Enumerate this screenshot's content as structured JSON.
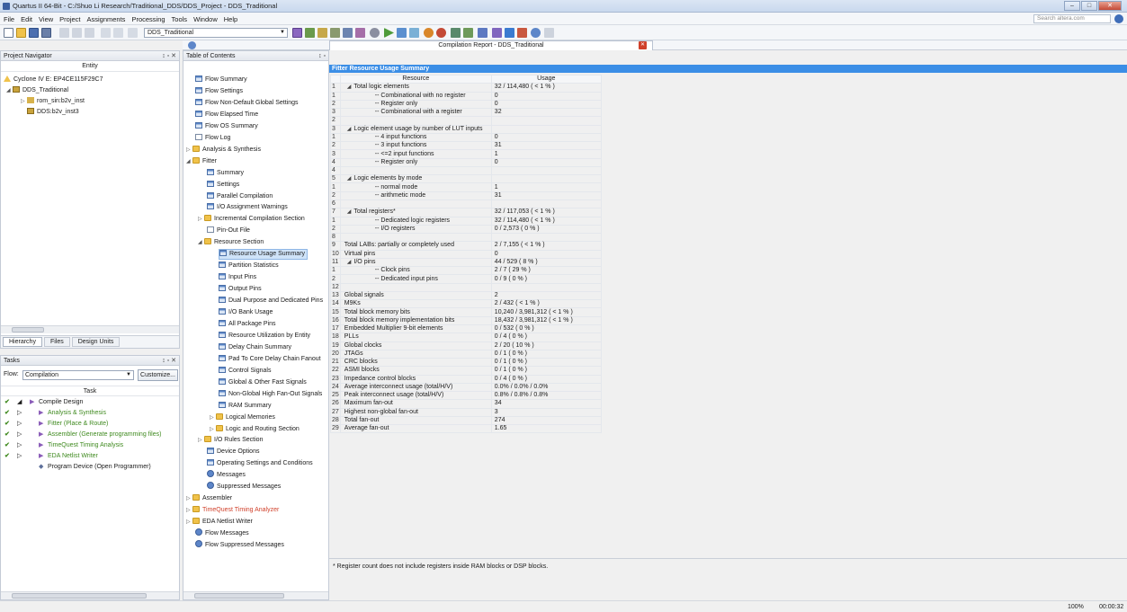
{
  "window": {
    "title": "Quartus II 64-Bit - C:/Shuo Li Research/Traditional_DDS/DDS_Project - DDS_Traditional",
    "buttons": [
      "–",
      "□",
      "✕"
    ]
  },
  "menubar": {
    "items": [
      "File",
      "Edit",
      "View",
      "Project",
      "Assignments",
      "Processing",
      "Tools",
      "Window",
      "Help"
    ],
    "search_placeholder": "Search altera.com"
  },
  "toolbar": {
    "revision": "DDS_Traditional"
  },
  "project_navigator": {
    "title": "Project Navigator",
    "header_controls": "↕ ▫ ✕",
    "column": "Entity",
    "device": "Cyclone IV E: EP4CE115F29C7",
    "tree": [
      {
        "label": "DDS_Traditional",
        "level": 0,
        "expanded": true
      },
      {
        "label": "rom_sin:b2v_inst",
        "level": 1,
        "expanded": false
      },
      {
        "label": "DDS:b2v_inst3",
        "level": 1,
        "expanded": null
      }
    ],
    "tabs": [
      "Hierarchy",
      "Files",
      "Design Units"
    ]
  },
  "tasks": {
    "title": "Tasks",
    "header_controls": "↕ ▫ ✕",
    "flow_label": "Flow:",
    "flow_value": "Compilation",
    "customize": "Customize...",
    "column": "Task",
    "items": [
      {
        "label": "Compile Design",
        "done": true,
        "level": 0,
        "green": false
      },
      {
        "label": "Analysis & Synthesis",
        "done": true,
        "level": 1,
        "green": true
      },
      {
        "label": "Fitter (Place & Route)",
        "done": true,
        "level": 1,
        "green": true
      },
      {
        "label": "Assembler (Generate programming files)",
        "done": true,
        "level": 1,
        "green": true
      },
      {
        "label": "TimeQuest Timing Analysis",
        "done": true,
        "level": 1,
        "green": true
      },
      {
        "label": "EDA Netlist Writer",
        "done": true,
        "level": 1,
        "green": true
      },
      {
        "label": "Program Device (Open Programmer)",
        "done": false,
        "level": 1,
        "green": false
      }
    ]
  },
  "toc": {
    "title": "Table of Contents",
    "header_controls": "↕ ▫",
    "items": [
      {
        "label": "Flow Summary",
        "icon": "table",
        "level": 0
      },
      {
        "label": "Flow Settings",
        "icon": "table",
        "level": 0
      },
      {
        "label": "Flow Non-Default Global Settings",
        "icon": "table",
        "level": 0
      },
      {
        "label": "Flow Elapsed Time",
        "icon": "table",
        "level": 0
      },
      {
        "label": "Flow OS Summary",
        "icon": "table",
        "level": 0
      },
      {
        "label": "Flow Log",
        "icon": "doc",
        "level": 0
      },
      {
        "label": "Analysis & Synthesis",
        "icon": "folder",
        "level": 0,
        "tri": "▷"
      },
      {
        "label": "Fitter",
        "icon": "folder",
        "level": 0,
        "tri": "◢"
      },
      {
        "label": "Summary",
        "icon": "table",
        "level": 1
      },
      {
        "label": "Settings",
        "icon": "table",
        "level": 1
      },
      {
        "label": "Parallel Compilation",
        "icon": "table",
        "level": 1
      },
      {
        "label": "I/O Assignment Warnings",
        "icon": "table",
        "level": 1
      },
      {
        "label": "Incremental Compilation Section",
        "icon": "folder",
        "level": 1,
        "tri": "▷"
      },
      {
        "label": "Pin-Out File",
        "icon": "doc",
        "level": 1
      },
      {
        "label": "Resource Section",
        "icon": "folder",
        "level": 1,
        "tri": "◢"
      },
      {
        "label": "Resource Usage Summary",
        "icon": "table",
        "level": 2,
        "selected": true
      },
      {
        "label": "Partition Statistics",
        "icon": "table",
        "level": 2
      },
      {
        "label": "Input Pins",
        "icon": "table",
        "level": 2
      },
      {
        "label": "Output Pins",
        "icon": "table",
        "level": 2
      },
      {
        "label": "Dual Purpose and Dedicated Pins",
        "icon": "table",
        "level": 2
      },
      {
        "label": "I/O Bank Usage",
        "icon": "table",
        "level": 2
      },
      {
        "label": "All Package Pins",
        "icon": "table",
        "level": 2
      },
      {
        "label": "Resource Utilization by Entity",
        "icon": "table",
        "level": 2
      },
      {
        "label": "Delay Chain Summary",
        "icon": "table",
        "level": 2
      },
      {
        "label": "Pad To Core Delay Chain Fanout",
        "icon": "table",
        "level": 2
      },
      {
        "label": "Control Signals",
        "icon": "table",
        "level": 2
      },
      {
        "label": "Global & Other Fast Signals",
        "icon": "table",
        "level": 2
      },
      {
        "label": "Non-Global High Fan-Out Signals",
        "icon": "table",
        "level": 2
      },
      {
        "label": "RAM Summary",
        "icon": "table",
        "level": 2
      },
      {
        "label": "Logical Memories",
        "icon": "folder",
        "level": 2,
        "tri": "▷"
      },
      {
        "label": "Logic and Routing Section",
        "icon": "folder",
        "level": 2,
        "tri": "▷"
      },
      {
        "label": "I/O Rules Section",
        "icon": "folder",
        "level": 1,
        "tri": "▷"
      },
      {
        "label": "Device Options",
        "icon": "table",
        "level": 1
      },
      {
        "label": "Operating Settings and Conditions",
        "icon": "table",
        "level": 1
      },
      {
        "label": "Messages",
        "icon": "info",
        "level": 1
      },
      {
        "label": "Suppressed Messages",
        "icon": "info",
        "level": 1
      },
      {
        "label": "Assembler",
        "icon": "folder",
        "level": 0,
        "tri": "▷"
      },
      {
        "label": "TimeQuest Timing Analyzer",
        "icon": "folder",
        "level": 0,
        "tri": "▷",
        "red": true
      },
      {
        "label": "EDA Netlist Writer",
        "icon": "folder",
        "level": 0,
        "tri": "▷"
      },
      {
        "label": "Flow Messages",
        "icon": "info",
        "level": 0
      },
      {
        "label": "Flow Suppressed Messages",
        "icon": "info",
        "level": 0
      }
    ]
  },
  "report": {
    "tab_title": "Compilation Report - DDS_Traditional",
    "heading": "Fitter Resource Usage Summary",
    "col_resource": "Resource",
    "col_usage": "Usage",
    "rows": [
      {
        "n": "1",
        "r": "Total logic elements",
        "u": "32 / 114,480 ( < 1 % )",
        "ind": 1,
        "tri": "◢"
      },
      {
        "n": "1",
        "r": "-- Combinational with no register",
        "u": "0",
        "ind": 2
      },
      {
        "n": "2",
        "r": "-- Register only",
        "u": "0",
        "ind": 2
      },
      {
        "n": "3",
        "r": "-- Combinational with a register",
        "u": "32",
        "ind": 2
      },
      {
        "n": "2",
        "r": "",
        "u": "",
        "ind": 0
      },
      {
        "n": "3",
        "r": "Logic element usage by number of LUT inputs",
        "u": "",
        "ind": 1,
        "tri": "◢"
      },
      {
        "n": "1",
        "r": "-- 4 input functions",
        "u": "0",
        "ind": 2
      },
      {
        "n": "2",
        "r": "-- 3 input functions",
        "u": "31",
        "ind": 2
      },
      {
        "n": "3",
        "r": "-- <=2 input functions",
        "u": "1",
        "ind": 2
      },
      {
        "n": "4",
        "r": "-- Register only",
        "u": "0",
        "ind": 2
      },
      {
        "n": "4",
        "r": "",
        "u": "",
        "ind": 0
      },
      {
        "n": "5",
        "r": "Logic elements by mode",
        "u": "",
        "ind": 1,
        "tri": "◢"
      },
      {
        "n": "1",
        "r": "-- normal mode",
        "u": "1",
        "ind": 2
      },
      {
        "n": "2",
        "r": "-- arithmetic mode",
        "u": "31",
        "ind": 2
      },
      {
        "n": "6",
        "r": "",
        "u": "",
        "ind": 0
      },
      {
        "n": "7",
        "r": "Total registers*",
        "u": "32 / 117,053 ( < 1 % )",
        "ind": 1,
        "tri": "◢"
      },
      {
        "n": "1",
        "r": "-- Dedicated logic registers",
        "u": "32 / 114,480 ( < 1 % )",
        "ind": 2
      },
      {
        "n": "2",
        "r": "-- I/O registers",
        "u": "0 / 2,573 ( 0 % )",
        "ind": 2
      },
      {
        "n": "8",
        "r": "",
        "u": "",
        "ind": 0
      },
      {
        "n": "9",
        "r": "Total LABs:  partially or completely used",
        "u": "2 / 7,155 ( < 1 % )",
        "ind": 0
      },
      {
        "n": "10",
        "r": "Virtual pins",
        "u": "0",
        "ind": 0
      },
      {
        "n": "11",
        "r": "I/O pins",
        "u": "44 / 529 ( 8 % )",
        "ind": 0,
        "tri": "◢"
      },
      {
        "n": "1",
        "r": "-- Clock pins",
        "u": "2 / 7 ( 29 % )",
        "ind": 2
      },
      {
        "n": "2",
        "r": "-- Dedicated input pins",
        "u": "0 / 9 ( 0 % )",
        "ind": 2
      },
      {
        "n": "12",
        "r": "",
        "u": "",
        "ind": 0
      },
      {
        "n": "13",
        "r": "Global signals",
        "u": "2",
        "ind": 0
      },
      {
        "n": "14",
        "r": "M9Ks",
        "u": "2 / 432 ( < 1 % )",
        "ind": 0
      },
      {
        "n": "15",
        "r": "Total block memory bits",
        "u": "10,240 / 3,981,312 ( < 1 % )",
        "ind": 0
      },
      {
        "n": "16",
        "r": "Total block memory implementation bits",
        "u": "18,432 / 3,981,312 ( < 1 % )",
        "ind": 0
      },
      {
        "n": "17",
        "r": "Embedded Multiplier 9-bit elements",
        "u": "0 / 532 ( 0 % )",
        "ind": 0
      },
      {
        "n": "18",
        "r": "PLLs",
        "u": "0 / 4 ( 0 % )",
        "ind": 0
      },
      {
        "n": "19",
        "r": "Global clocks",
        "u": "2 / 20 ( 10 % )",
        "ind": 0
      },
      {
        "n": "20",
        "r": "JTAGs",
        "u": "0 / 1 ( 0 % )",
        "ind": 0
      },
      {
        "n": "21",
        "r": "CRC blocks",
        "u": "0 / 1 ( 0 % )",
        "ind": 0
      },
      {
        "n": "22",
        "r": "ASMI blocks",
        "u": "0 / 1 ( 0 % )",
        "ind": 0
      },
      {
        "n": "23",
        "r": "Impedance control blocks",
        "u": "0 / 4 ( 0 % )",
        "ind": 0
      },
      {
        "n": "24",
        "r": "Average interconnect usage (total/H/V)",
        "u": "0.0% / 0.0% / 0.0%",
        "ind": 0
      },
      {
        "n": "25",
        "r": "Peak interconnect usage (total/H/V)",
        "u": "0.8% / 0.8% / 0.8%",
        "ind": 0
      },
      {
        "n": "26",
        "r": "Maximum fan-out",
        "u": "34",
        "ind": 0
      },
      {
        "n": "27",
        "r": "Highest non-global fan-out",
        "u": "3",
        "ind": 0
      },
      {
        "n": "28",
        "r": "Total fan-out",
        "u": "274",
        "ind": 0
      },
      {
        "n": "29",
        "r": "Average fan-out",
        "u": "1.65",
        "ind": 0
      }
    ],
    "footnote": "* Register count does not include registers inside RAM blocks or DSP blocks."
  },
  "status": {
    "zoom": "100%",
    "time": "00:00:32"
  },
  "colors": {
    "accent": "#3b8ee6",
    "selected": "#cfe3f8",
    "green": "#3f8a1f",
    "red": "#d0402a"
  }
}
